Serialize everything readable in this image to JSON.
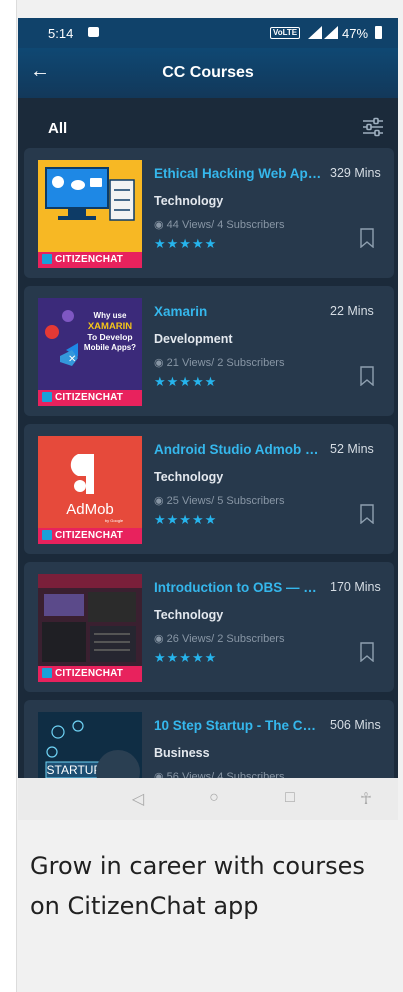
{
  "status": {
    "time": "5:14",
    "network_badge": "VoLTE",
    "battery": "47%"
  },
  "appbar": {
    "title": "CC Courses"
  },
  "filter": {
    "label": "All"
  },
  "brand_label": "CITIZENCHAT",
  "courses": [
    {
      "title": "Ethical Hacking Web Applications",
      "mins": "329 Mins",
      "category": "Technology",
      "stats": "44 Views/ 4 Subscribers",
      "stars": "★★★★★"
    },
    {
      "title": "Xamarin",
      "mins": "22 Mins",
      "category": "Development",
      "stats": "21 Views/ 2 Subscribers",
      "stars": "★★★★★",
      "thumb_text": [
        "Why use",
        "XAMARIN",
        "To Develop",
        "Mobile Apps?"
      ]
    },
    {
      "title": "Android Studio Admob Integration",
      "mins": "52 Mins",
      "category": "Technology",
      "stats": "25 Views/ 5 Subscribers",
      "stars": "★★★★★",
      "thumb_text": [
        "AdMob",
        "by Google"
      ]
    },
    {
      "title": "Introduction to OBS — Open Broadcaster Software",
      "mins": "170 Mins",
      "category": "Technology",
      "stats": "26 Views/ 2 Subscribers",
      "stars": "★★★★★"
    },
    {
      "title": "10 Step Startup - The Complete Guide",
      "mins": "506 Mins",
      "category": "Business",
      "stats": "56 Views/ 4 Subscribers",
      "stars": "★★★★★",
      "thumb_text": [
        "STARTUP"
      ]
    }
  ],
  "caption": "Grow in career with courses on CitizenChat app",
  "colors": {
    "appbar": "#10426a",
    "background": "#1b2a3a",
    "card": "#27394c",
    "title_accent": "#35b7ec",
    "brand": "#e8225d"
  }
}
